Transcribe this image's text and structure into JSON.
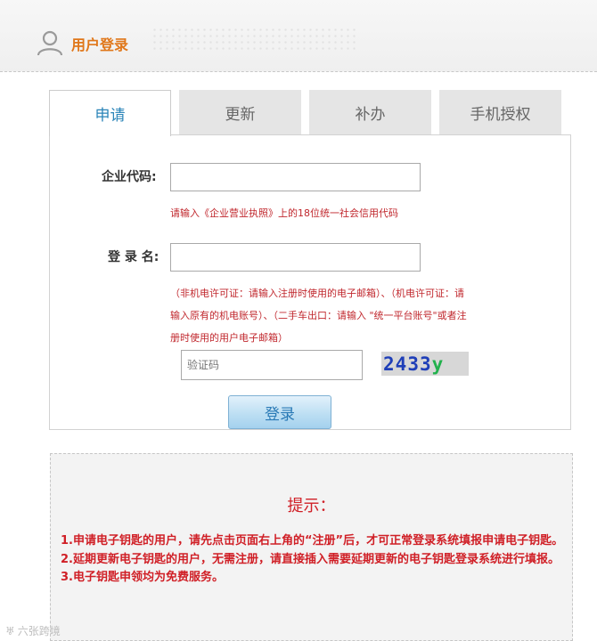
{
  "header": {
    "title": "用户登录"
  },
  "tabs": [
    {
      "label": "申请",
      "active": true
    },
    {
      "label": "更新",
      "active": false
    },
    {
      "label": "补办",
      "active": false
    },
    {
      "label": "手机授权",
      "active": false
    }
  ],
  "form": {
    "company_code_label": "企业代码:",
    "company_code_value": "",
    "company_code_hint": "请输入《企业营业执照》上的18位统一社会信用代码",
    "login_name_label": "登 录 名:",
    "login_name_value": "",
    "login_name_hint_1": "（非机电许可证：请输入注册时使用的电子邮箱）、（机电许可证：请",
    "login_name_hint_2": "输入原有的机电账号）、（二手车出口：请输入 \"统一平台账号\"或者注",
    "login_name_hint_3": "册时使用的用户电子邮箱）",
    "captcha_placeholder": "验证码",
    "captcha_chars": [
      "2",
      "4",
      "3",
      "3",
      "y"
    ],
    "captcha_colors": [
      "#1f3fb8",
      "#1f3fb8",
      "#1f3fb8",
      "#1f3fb8",
      "#22b14c"
    ],
    "login_button": "登录"
  },
  "tips": {
    "title": "提示：",
    "items": [
      "1.申请电子钥匙的用户，请先点击页面右上角的“注册”后，才可正常登录系统填报申请电子钥匙。",
      "2.延期更新电子钥匙的用户，无需注册，请直接插入需要延期更新的电子钥匙登录系统进行填报。",
      "3.电子钥匙申领均为免费服务。"
    ]
  },
  "watermark": "六张跨境"
}
